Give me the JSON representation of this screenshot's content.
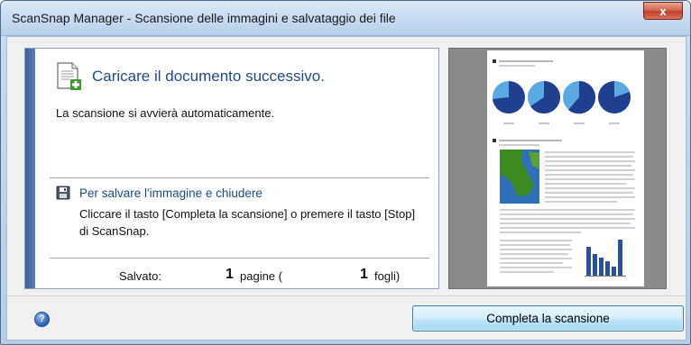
{
  "window": {
    "title": "ScanSnap Manager - Scansione delle immagini e salvataggio dei file",
    "close_label": "x"
  },
  "main": {
    "heading": "Caricare il documento successivo.",
    "subtext": "La scansione si avvierà automaticamente.",
    "save_link": "Per salvare l'immagine e chiudere",
    "instructions": "Cliccare il tasto [Completa la scansione] o premere il tasto [Stop] di ScanSnap."
  },
  "status": {
    "saved_label": "Salvato:",
    "pages_count": "1",
    "pages_unit": "pagine (",
    "sheets_count": "1",
    "sheets_unit": "fogli)"
  },
  "footer": {
    "help_glyph": "?",
    "complete_button": "Completa la scansione"
  },
  "icons": {
    "document": "document-add-icon",
    "save": "floppy-disk-icon",
    "help": "help-icon"
  },
  "colors": {
    "accent_text": "#1f4a8a",
    "stripe": "#3d5f98",
    "preview_chart": "#1f3f8f",
    "preview_map": "#3c8a22"
  }
}
